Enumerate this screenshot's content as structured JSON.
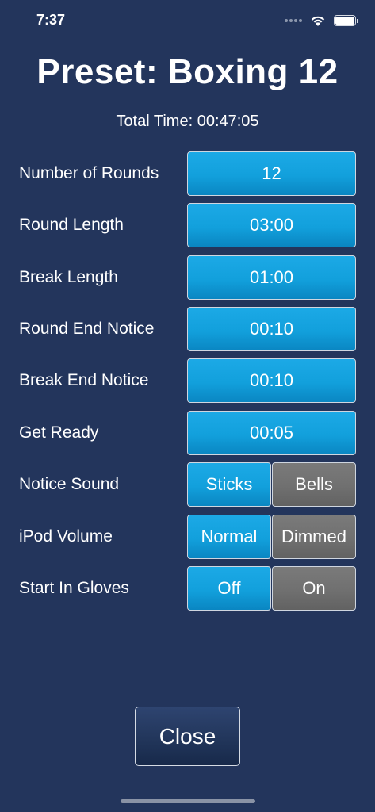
{
  "status_bar": {
    "time": "7:37",
    "icons": [
      "signal-dots-icon",
      "wifi-icon",
      "battery-icon"
    ]
  },
  "title": "Preset: Boxing 12",
  "total_time": "Total Time: 00:47:05",
  "settings": {
    "number_of_rounds": {
      "label": "Number of Rounds",
      "value": "12"
    },
    "round_length": {
      "label": "Round Length",
      "value": "03:00"
    },
    "break_length": {
      "label": "Break Length",
      "value": "01:00"
    },
    "round_end_notice": {
      "label": "Round End Notice",
      "value": "00:10"
    },
    "break_end_notice": {
      "label": "Break End Notice",
      "value": "00:10"
    },
    "get_ready": {
      "label": "Get Ready",
      "value": "00:05"
    },
    "notice_sound": {
      "label": "Notice Sound",
      "options": [
        "Sticks",
        "Bells"
      ],
      "selected": "Sticks"
    },
    "ipod_volume": {
      "label": "iPod Volume",
      "options": [
        "Normal",
        "Dimmed"
      ],
      "selected": "Normal"
    },
    "start_in_gloves": {
      "label": "Start In Gloves",
      "options": [
        "Off",
        "On"
      ],
      "selected": "Off"
    }
  },
  "close_label": "Close",
  "colors": {
    "background": "#23355c",
    "accent_selected": "#12a0dc",
    "unselected": "#707070"
  }
}
